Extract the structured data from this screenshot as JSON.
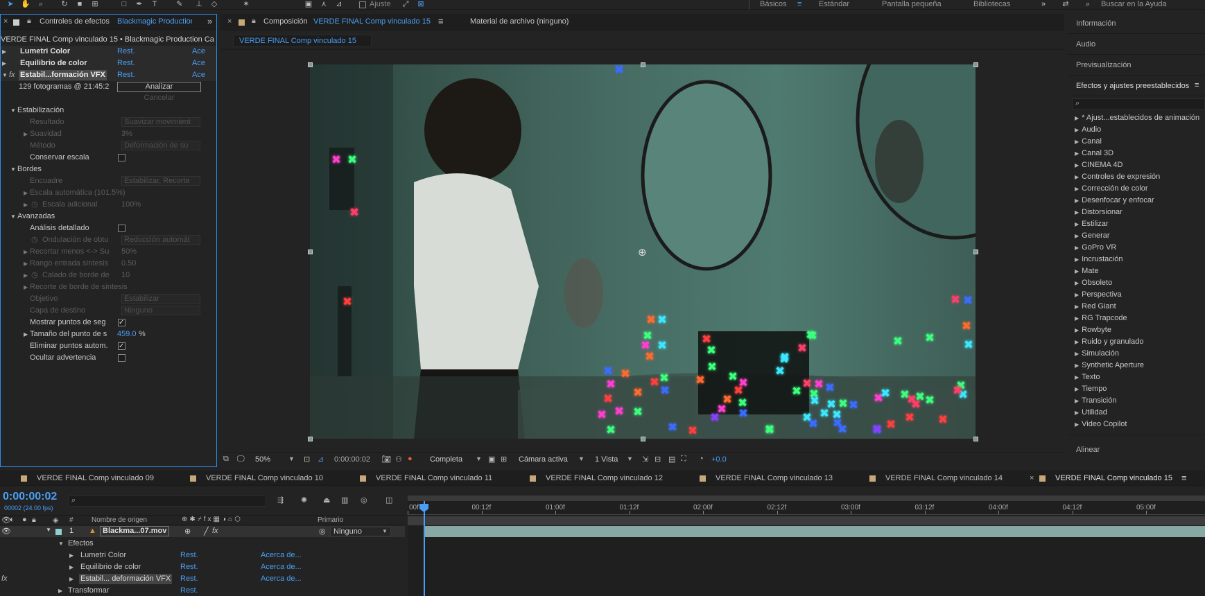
{
  "toolbar": {
    "ajuste_label": "Ajuste",
    "workspaces": [
      "Básicos",
      "Estándar",
      "Pantalla pequeña",
      "Bibliotecas"
    ],
    "more_label": "»",
    "search_placeholder": "Buscar en la Ayuda"
  },
  "effects_panel": {
    "tab_label": "Controles de efectos",
    "tab_layer": "Blackmagic Production",
    "breadcrumb": "VERDE FINAL Comp vinculado 15 • Blackmagic Production Ca",
    "effects": [
      {
        "name": "Lumetri Color",
        "reset": "Rest.",
        "about": "Ace"
      },
      {
        "name": "Equilibrio de color",
        "reset": "Rest.",
        "about": "Ace"
      },
      {
        "name": "Estabil...formación VFX",
        "reset": "Rest.",
        "about": "Ace"
      }
    ],
    "frames_info": "129 fotogramas @ 21:45:2",
    "analyze_label": "Analizar",
    "cancel_label": "Cancelar",
    "stabilization": {
      "title": "Estabilización",
      "result_label": "Resultado",
      "result_value": "Suavizar movimient",
      "smoothness_label": "Suavidad",
      "smoothness_value": "3%",
      "method_label": "Método",
      "method_value": "Deformación de su",
      "keep_scale_label": "Conservar escala"
    },
    "borders": {
      "title": "Bordes",
      "frame_label": "Encuadre",
      "frame_value": "Estabilizar, Recorte",
      "auto_scale_label": "Escala automática (101.5%)",
      "extra_scale_label": "Escala adicional",
      "extra_scale_value": "100%"
    },
    "advanced": {
      "title": "Avanzadas",
      "detailed_label": "Análisis detallado",
      "rolling_label": "Ondulación de obtu",
      "rolling_value": "Reducción automát",
      "crop_label": "Recortar menos <-> Su",
      "crop_value": "50%",
      "synth_range_label": "Rango entrada síntesis",
      "synth_range_value": "0.50",
      "feather_label": "Calado de borde de",
      "feather_value": "10",
      "synth_crop_label": "Recorte de borde de síntesis",
      "target_label": "Objetivo",
      "target_value": "Estabilizar",
      "dest_layer_label": "Capa de destino",
      "dest_layer_value": "Ninguno",
      "show_points_label": "Mostrar puntos de seg",
      "point_size_label": "Tamaño del punto de s",
      "point_size_value": "459.0",
      "point_size_unit": "%",
      "auto_delete_label": "Eliminar puntos autom.",
      "hide_warning_label": "Ocultar advertencia"
    }
  },
  "comp_panel": {
    "tab_prefix": "Composición",
    "tab_name": "VERDE FINAL Comp vinculado 15",
    "footage_tab": "Material de archivo  (ninguno)",
    "subtab": "VERDE FINAL Comp vinculado 15",
    "zoom": "50%",
    "timecode": "0:00:00:02",
    "resolution": "Completa",
    "camera": "Cámara activa",
    "views": "1 Vista",
    "exposure": "+0.0"
  },
  "right_panel": {
    "info": "Información",
    "audio": "Audio",
    "preview": "Previsualización",
    "effects_presets": "Efectos y ajustes preestablecidos",
    "search_placeholder": "",
    "categories": [
      "* Ajust...establecidos de animación",
      "Audio",
      "Canal",
      "Canal 3D",
      "CINEMA 4D",
      "Controles de expresión",
      "Corrección de color",
      "Desenfocar y enfocar",
      "Distorsionar",
      "Estilizar",
      "Generar",
      "GoPro VR",
      "Incrustación",
      "Mate",
      "Obsoleto",
      "Perspectiva",
      "Red Giant",
      "RG Trapcode",
      "Rowbyte",
      "Ruido y granulado",
      "Simulación",
      "Synthetic Aperture",
      "Texto",
      "Tiempo",
      "Transición",
      "Utilidad",
      "Video Copilot"
    ],
    "align": "Alinear"
  },
  "timeline": {
    "tabs": [
      "VERDE FINAL Comp vinculado 09",
      "VERDE FINAL Comp vinculado 10",
      "VERDE FINAL Comp vinculado 11",
      "VERDE FINAL Comp vinculado 12",
      "VERDE FINAL Comp vinculado 13",
      "VERDE FINAL Comp vinculado 14",
      "VERDE FINAL Comp vinculado 15"
    ],
    "timecode": "0:00:00:02",
    "fps": "00002 (24.00 fps)",
    "col_source_name": "Nombre de origen",
    "col_parent": "Primario",
    "col_number": "#",
    "layer": {
      "number": "1",
      "name": "Blackma...07.mov",
      "parent": "Ninguno"
    },
    "effects_group": "Efectos",
    "effect_rows": [
      {
        "name": "Lumetri Color",
        "reset": "Rest.",
        "about": "Acerca de..."
      },
      {
        "name": "Equilibrio de color",
        "reset": "Rest.",
        "about": "Acerca de..."
      },
      {
        "name": "Estabil... deformación VFX",
        "reset": "Rest.",
        "about": "Acerca de..."
      }
    ],
    "transform": {
      "name": "Transformar",
      "reset": "Rest."
    },
    "ruler": [
      "00f",
      "00:12f",
      "01:00f",
      "01:12f",
      "02:00f",
      "02:12f",
      "03:00f",
      "03:12f",
      "04:00f",
      "04:12f",
      "05:00f"
    ]
  },
  "colors": {
    "accent": "#4a9ff5",
    "panel_bg": "#232323",
    "panel_border_active": "#2d8ceb",
    "comp_swatch": "#c8a878"
  }
}
